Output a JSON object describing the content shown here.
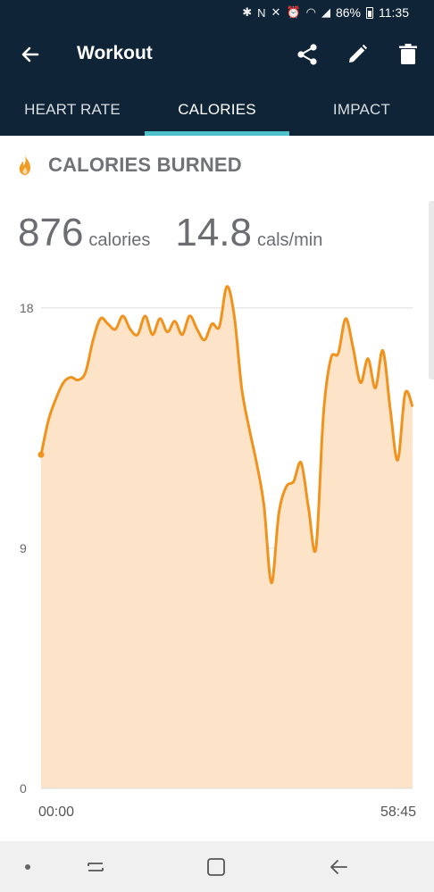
{
  "status_bar": {
    "battery_percent": "86%",
    "time": "11:35",
    "icons": [
      "bluetooth-icon",
      "nfc-icon",
      "mute-icon",
      "alarm-icon",
      "wifi-icon",
      "signal-icon",
      "battery-icon"
    ]
  },
  "app_bar": {
    "title": "Workout",
    "icons": [
      "back-arrow-icon",
      "share-icon",
      "edit-icon",
      "delete-icon"
    ]
  },
  "tabs": [
    {
      "label": "HEART RATE",
      "active": false
    },
    {
      "label": "CALORIES",
      "active": true
    },
    {
      "label": "IMPACT",
      "active": false
    }
  ],
  "section": {
    "title": "CALORIES BURNED",
    "icon": "flame-icon",
    "icon_color": "#f29a21"
  },
  "stats": {
    "total_value": "876",
    "total_unit": "calories",
    "rate_value": "14.8",
    "rate_unit": "cals/min"
  },
  "colors": {
    "header_bg": "#0f2436",
    "tab_indicator": "#4dc3c9",
    "line": "#f0921c",
    "fill": "#fde4c9"
  },
  "chart_data": {
    "type": "area",
    "x_start_label": "00:00",
    "x_end_label": "58:45",
    "y_ticks": [
      "0",
      "9",
      "18"
    ],
    "ylim": [
      0,
      19.5
    ],
    "grid": true,
    "values": [
      12.5,
      13.8,
      14.6,
      15.2,
      15.4,
      15.3,
      15.6,
      16.8,
      17.6,
      17.4,
      17.2,
      17.7,
      17.2,
      17.0,
      17.7,
      17.0,
      17.6,
      17.1,
      17.5,
      17.0,
      17.7,
      17.2,
      16.8,
      17.4,
      17.3,
      18.8,
      17.7,
      15.0,
      13.5,
      12.2,
      10.6,
      7.7,
      10.3,
      11.3,
      11.5,
      12.2,
      10.5,
      9.0,
      14.0,
      16.1,
      16.3,
      17.6,
      16.5,
      15.2,
      16.1,
      15.0,
      16.4,
      14.2,
      12.3,
      14.8,
      14.3
    ]
  },
  "nav_bar": {
    "icons": [
      "dot-icon",
      "recent-apps-icon",
      "home-icon",
      "back-icon"
    ]
  }
}
